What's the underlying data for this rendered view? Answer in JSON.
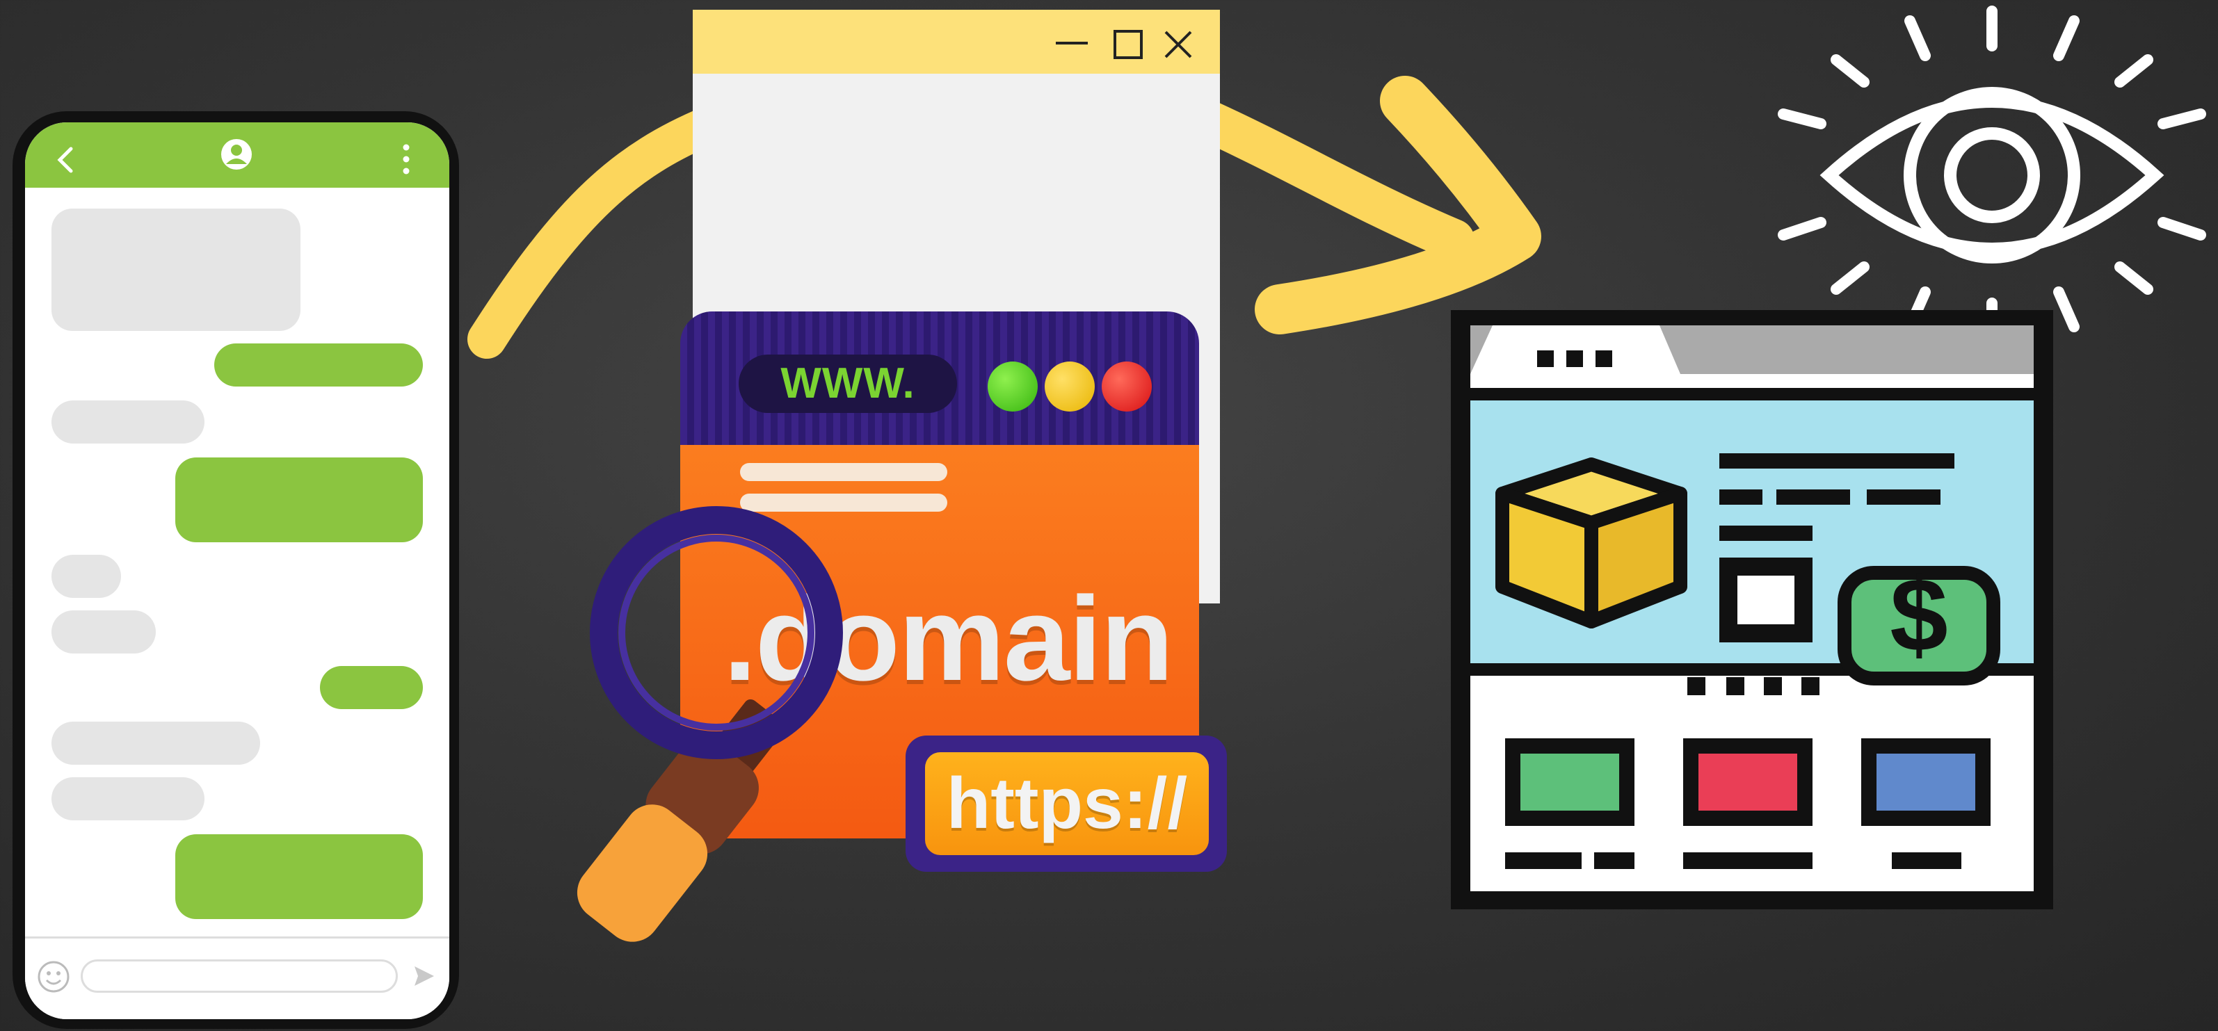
{
  "domain_card": {
    "www_label": "WWW.",
    "domain_label": ".domain",
    "https_label": "https://"
  },
  "colors": {
    "background": "#353535",
    "arrow": "#fcd65c",
    "phone_accent": "#8bc540",
    "window_title": "#fde17a",
    "web_header": "#aaaaaa",
    "web_content": "#a8e1ee",
    "cube": "#f2ca36",
    "money": "#5dc07a",
    "tile_green": "#5dc07a",
    "tile_red": "#ea3e56",
    "tile_blue": "#6089cc"
  },
  "icons": {
    "phone": [
      "back-arrow-icon",
      "user-avatar-icon",
      "more-vert-icon",
      "emoji-icon",
      "send-icon"
    ],
    "window": [
      "minimize-icon",
      "maximize-icon",
      "close-icon"
    ],
    "illustration": [
      "magnifying-glass-icon",
      "eye-icon",
      "cube-icon",
      "dollar-bill-icon"
    ]
  }
}
